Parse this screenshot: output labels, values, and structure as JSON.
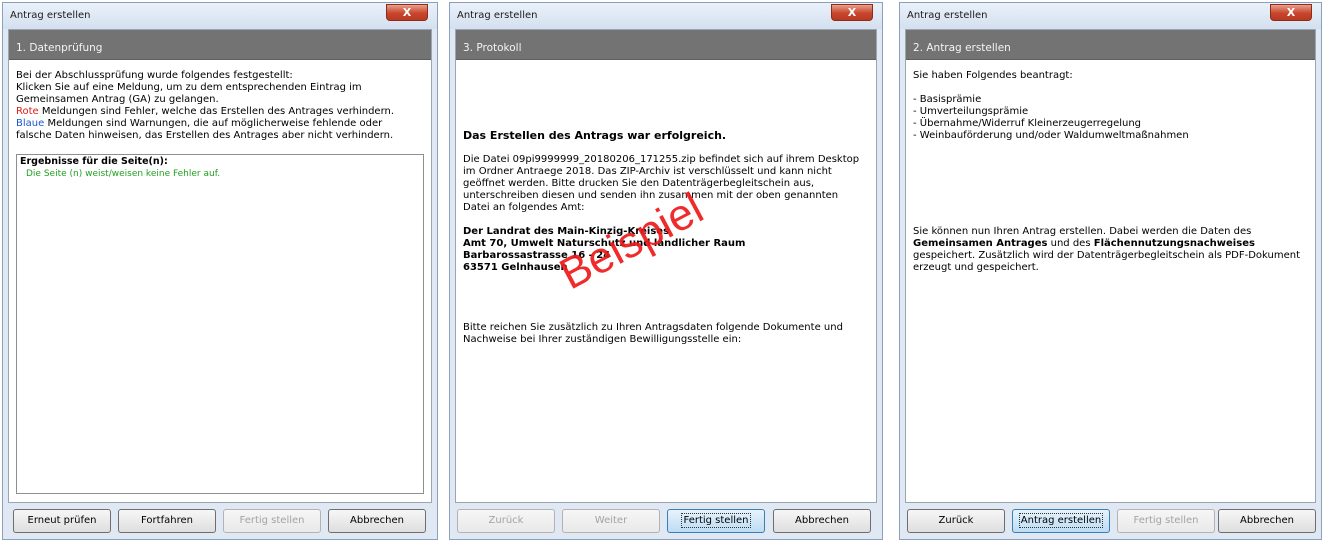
{
  "dialog1": {
    "title": "Antrag erstellen",
    "close_label": "X",
    "step_title": "1. Datenprüfung",
    "intro_lines": [
      "Bei der Abschlussprüfung wurde folgendes festgestellt:",
      "Klicken Sie auf eine Meldung, um zu dem entsprechenden Eintrag im",
      "Gemeinsamen Antrag (GA) zu gelangen."
    ],
    "red_word": "Rote",
    "red_rest": " Meldungen sind Fehler, welche das Erstellen des Antrages verhindern.",
    "blue_word": "Blaue",
    "blue_rest": " Meldungen sind Warnungen, die auf möglicherweise fehlende oder",
    "blue_line2": "falsche Daten hinweisen, das Erstellen des Antrages aber nicht verhindern.",
    "results_header": "Ergebnisse für die Seite(n):",
    "results_line": "Die Seite (n) weist/weisen keine Fehler auf.",
    "buttons": [
      "Erneut prüfen",
      "Fortfahren",
      "Fertig stellen",
      "Abbrechen"
    ]
  },
  "dialog2": {
    "title": "Antrag erstellen",
    "close_label": "X",
    "step_title": "3. Protokoll",
    "success_heading": "Das Erstellen des Antrags war erfolgreich.",
    "body_lines": [
      "Die Datei 09pi9999999_20180206_171255.zip befindet sich auf ihrem Desktop",
      "im Ordner Antraege 2018. Das ZIP-Archiv ist verschlüsselt und kann nicht",
      "geöffnet werden. Bitte drucken Sie den Datenträgerbegleitschein aus,",
      "unterschreiben diesen und senden ihn zusammen mit der oben genannten",
      "Datei an folgendes Amt:"
    ],
    "address_lines": [
      "Der Landrat des Main-Kinzig-Kreises",
      "Amt 70, Umwelt Naturschutz und ländlicher Raum",
      "Barbarossastrasse 16 - 24",
      "63571 Gelnhausen"
    ],
    "footer_lines": [
      "Bitte reichen Sie zusätzlich zu Ihren Antragsdaten folgende Dokumente und",
      "Nachweise bei Ihrer zuständigen Bewilligungsstelle ein:"
    ],
    "watermark": "Beispiel",
    "buttons": [
      "Zurück",
      "Weiter",
      "Fertig stellen",
      "Abbrechen"
    ]
  },
  "dialog3": {
    "title": "Antrag erstellen",
    "close_label": "X",
    "step_title": "2. Antrag erstellen",
    "intro": "Sie haben Folgendes beantragt:",
    "items": [
      "- Basisprämie",
      "- Umverteilungsprämie",
      "- Übernahme/Widerruf Kleinerzeugerregelung",
      "- Weinbauförderung und/oder Waldumweltmaßnahmen"
    ],
    "info_line1": "Sie können nun Ihren Antrag erstellen. Dabei werden die Daten des",
    "info_bold1": "Gemeinsamen Antrages",
    "info_mid": " und des ",
    "info_bold2": "Flächennutzungsnachweises",
    "info_line3": "gespeichert. Zusätzlich wird der Datenträgerbegleitschein als PDF-Dokument",
    "info_line4": "erzeugt und gespeichert.",
    "buttons": [
      "Zurück",
      "Antrag erstellen",
      "Fertig stellen",
      "Abbrechen"
    ]
  }
}
